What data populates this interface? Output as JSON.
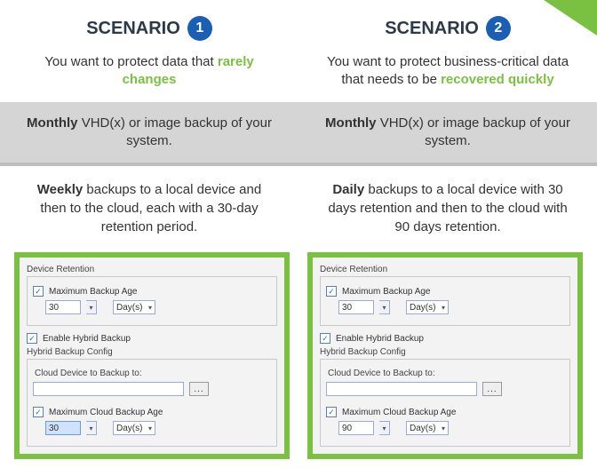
{
  "scenarios": [
    {
      "title": "SCENARIO",
      "number": "1",
      "desc_pre": "You want to protect data that",
      "desc_hl": "rarely changes",
      "desc_post": "",
      "band1_strong": "Monthly",
      "band1_rest": " VHD(x) or image backup of your system.",
      "band2_strong": "Weekly",
      "band2_rest": " backups to a local device and then to the cloud, each with a 30-day retention period."
    },
    {
      "title": "SCENARIO",
      "number": "2",
      "desc_pre": "You want to protect business-critical data that needs to be ",
      "desc_hl": "recovered quickly",
      "desc_post": "",
      "band1_strong": "Monthly",
      "band1_rest": " VHD(x) or image backup of your system.",
      "band2_strong": "Daily",
      "band2_rest": " backups to a local device with 30 days retention and then to the cloud with 90 days retention."
    }
  ],
  "panel_labels": {
    "device_retention": "Device Retention",
    "max_backup_age": "Maximum Backup Age",
    "enable_hybrid": "Enable Hybrid Backup",
    "hybrid_config": "Hybrid Backup Config",
    "cloud_device": "Cloud Device to Backup to:",
    "max_cloud_age": "Maximum Cloud Backup Age",
    "days": "Day(s)",
    "checkmark": "✓",
    "browse": "..."
  },
  "panel_values": {
    "left": {
      "local_age": "30",
      "cloud_age": "30",
      "cloud_age_selected": true
    },
    "right": {
      "local_age": "30",
      "cloud_age": "90",
      "cloud_age_selected": false
    }
  }
}
